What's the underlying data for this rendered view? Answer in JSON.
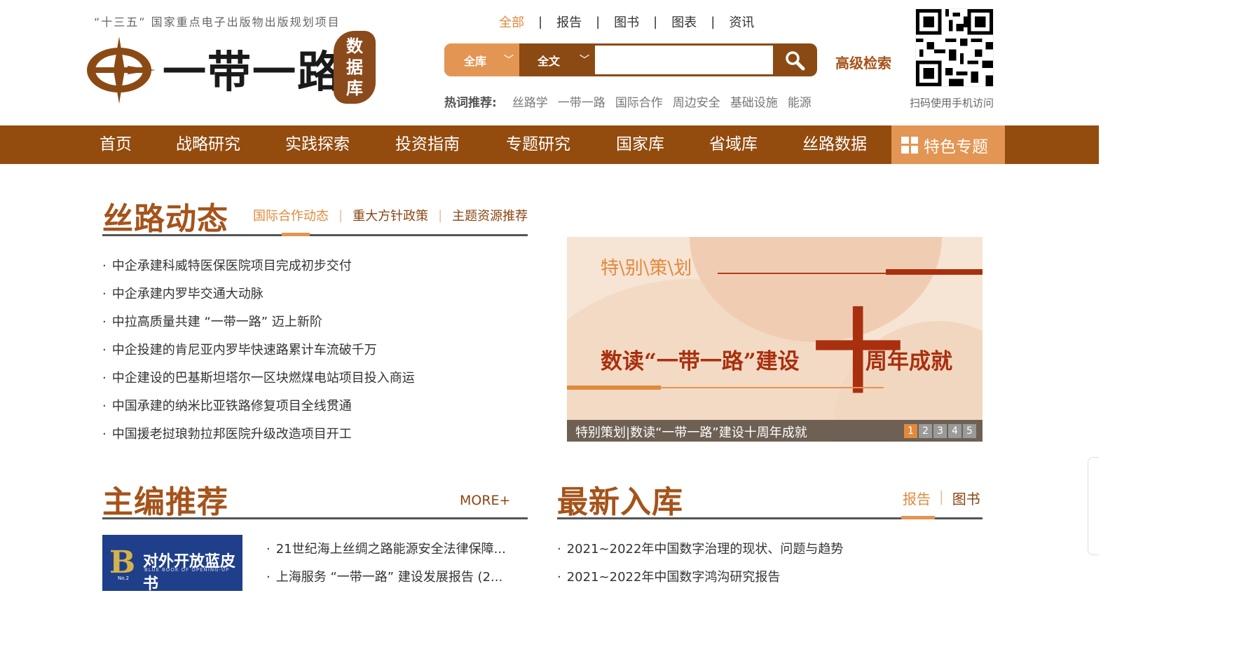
{
  "header": {
    "tagline": "“十三五” 国家重点电子出版物出版规划项目",
    "logo_text": "一带一路",
    "seal_chars": [
      "数",
      "据",
      "库"
    ]
  },
  "topnav": {
    "items": [
      {
        "label": "全部",
        "active": true
      },
      {
        "label": "报告",
        "active": false
      },
      {
        "label": "图书",
        "active": false
      },
      {
        "label": "图表",
        "active": false
      },
      {
        "label": "资讯",
        "active": false
      }
    ],
    "separator": "|"
  },
  "search": {
    "scope_select": "全库",
    "field_select": "全文",
    "query": "",
    "advanced_label": "高级检索"
  },
  "hot": {
    "label": "热词推荐:",
    "keywords": [
      "丝路学",
      "一带一路",
      "国际合作",
      "周边安全",
      "基础设施",
      "能源"
    ]
  },
  "qr": {
    "caption": "扫码使用手机访问"
  },
  "mainnav": {
    "items": [
      "首页",
      "战略研究",
      "实践探索",
      "投资指南",
      "专题研究",
      "国家库",
      "省域库",
      "丝路数据"
    ],
    "special": "特色专题"
  },
  "silk_news": {
    "title": "丝路动态",
    "tabs": [
      {
        "label": "国际合作动态",
        "active": true
      },
      {
        "label": "重大方针政策",
        "active": false
      },
      {
        "label": "主题资源推荐",
        "active": false
      }
    ],
    "items": [
      "中企承建科威特医保医院项目完成初步交付",
      "中企承建内罗毕交通大动脉",
      "中拉高质量共建 “一带一路” 迈上新阶",
      "中企投建的肯尼亚内罗毕快速路累计车流破千万",
      "中企建设的巴基斯坦塔尔一区块燃煤电站项目投入商运",
      "中国承建的纳米比亚铁路修复项目全线贯通",
      "中国援老挝琅勃拉邦医院升级改造项目开工"
    ]
  },
  "banner": {
    "kicker": "特\\别\\策\\划",
    "headline_left": "数读“一带一路”建设",
    "headline_big": "十",
    "headline_right": "周年成就",
    "caption": "特别策划|数读“一带一路”建设十周年成就",
    "pages": [
      "1",
      "2",
      "3",
      "4",
      "5"
    ],
    "active_page": 1
  },
  "editor_pick": {
    "title": "主编推荐",
    "more": "MORE+",
    "book": {
      "letter": "B",
      "title": "对外开放蓝皮书",
      "subtitle": "BLUE BOOK OF OPENING-UP",
      "no": "No.2"
    },
    "items": [
      "21世纪海上丝绸之路能源安全法律保障...",
      "上海服务 “一带一路” 建设发展报告 (2..."
    ]
  },
  "latest": {
    "title": "最新入库",
    "tabs": [
      {
        "label": "报告",
        "active": true
      },
      {
        "label": "图书",
        "active": false
      }
    ],
    "items": [
      "2021~2022年中国数字治理的现状、问题与趋势",
      "2021~2022年中国数字鸿沟研究报告"
    ]
  },
  "colors": {
    "brand_brown": "#934b0e",
    "accent_orange": "#e39553",
    "title_brown": "#a5531a"
  }
}
